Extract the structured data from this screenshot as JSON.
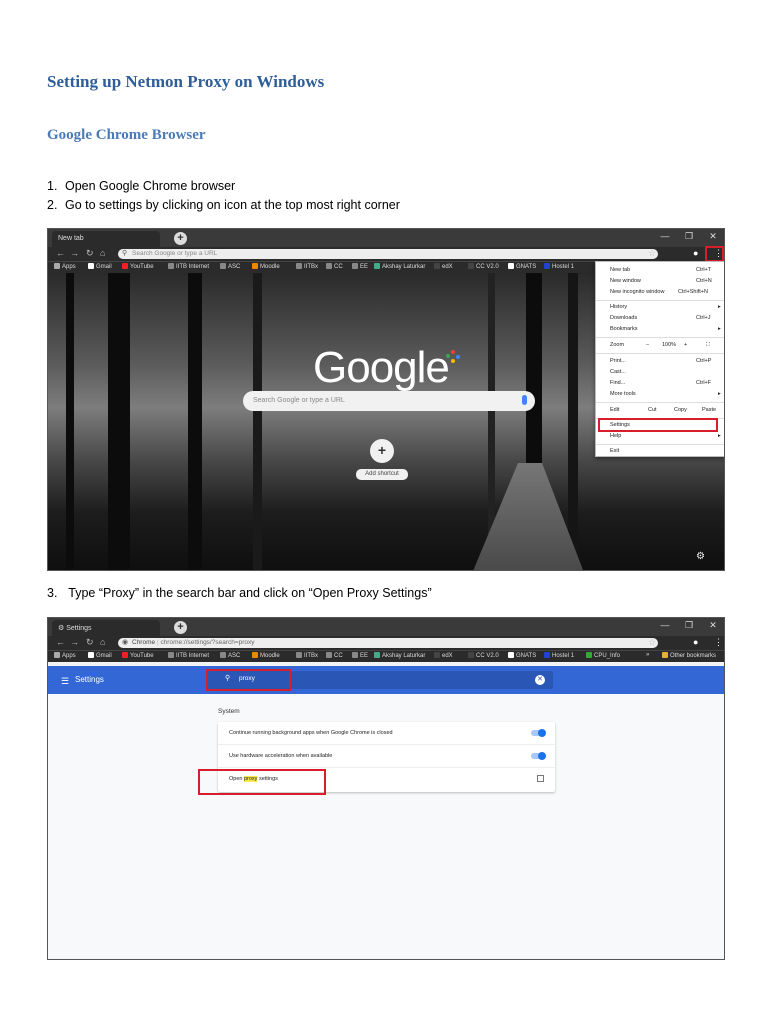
{
  "doc": {
    "title": "Setting up Netmon Proxy on Windows",
    "subtitle": "Google Chrome Browser",
    "steps": [
      {
        "num": "1.",
        "text": "Open Google Chrome browser"
      },
      {
        "num": "2.",
        "text": "Go to settings by clicking on icon at the top most right corner"
      },
      {
        "num": "3.",
        "text": " Type “Proxy” in the search bar and click on “Open Proxy Settings”"
      }
    ]
  },
  "shot1": {
    "tab_title": "New tab",
    "new_tab_icon": "plus-icon",
    "window_controls": [
      "—",
      "❐",
      "✕"
    ],
    "omnibox_placeholder": "Search Google or type a URL",
    "bookmarks": [
      "Apps",
      "Gmail",
      "YouTube",
      "IITB Internet",
      "ASC",
      "Moodle",
      "IITBx",
      "CC",
      "EE",
      "Akshay Laturkar",
      "edX",
      "CC V2.0",
      "GNATS",
      "Hostel 1"
    ],
    "logo": "Google",
    "search_placeholder": "Search Google or type a URL",
    "shortcut_plus": "+",
    "shortcut_label": "Add shortcut",
    "menu": {
      "new_tab": "New tab",
      "new_tab_sc": "Ctrl+T",
      "new_window": "New window",
      "new_window_sc": "Ctrl+N",
      "incognito": "New incognito window",
      "incognito_sc": "Ctrl+Shift+N",
      "history": "History",
      "downloads": "Downloads",
      "downloads_sc": "Ctrl+J",
      "bookmarks": "Bookmarks",
      "zoom": "Zoom",
      "zoom_minus": "−",
      "zoom_value": "100%",
      "zoom_plus": "+",
      "print": "Print...",
      "print_sc": "Ctrl+P",
      "cast": "Cast...",
      "find": "Find...",
      "find_sc": "Ctrl+F",
      "more_tools": "More tools",
      "edit": "Edit",
      "cut": "Cut",
      "copy": "Copy",
      "paste": "Paste",
      "settings": "Settings",
      "help": "Help",
      "exit": "Exit"
    }
  },
  "shot2": {
    "tab_title": "Settings",
    "url_prefix": "Chrome",
    "url_path": "chrome://settings/?search=proxy",
    "bookmarks": [
      "Apps",
      "Gmail",
      "YouTube",
      "IITB Internet",
      "ASC",
      "Moodle",
      "IITBx",
      "CC",
      "EE",
      "Akshay Laturkar",
      "edX",
      "CC V2.0",
      "GNATS",
      "Hostel 1",
      "CPU_Info",
      "»",
      "Other bookmarks"
    ],
    "appbar_title": "Settings",
    "search_value": "proxy",
    "section": "System",
    "rows": [
      {
        "label": "Continue running background apps when Google Chrome is closed"
      },
      {
        "label": "Use hardware acceleration when available"
      },
      {
        "label_pre": "Open ",
        "label_hl": "proxy",
        "label_post": " settings"
      }
    ]
  }
}
